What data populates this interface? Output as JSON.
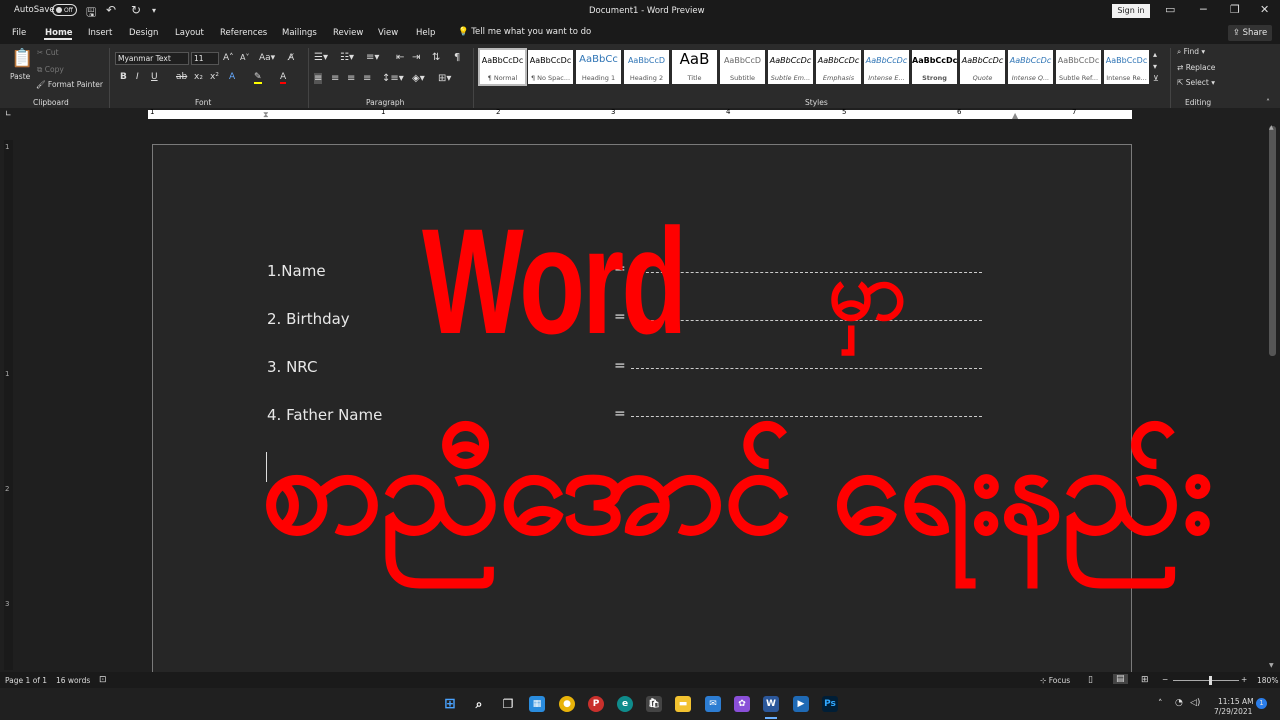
{
  "titlebar": {
    "autosave": "AutoSave",
    "toggle": "Off",
    "doc_title": "Document1  -  Word Preview",
    "sign_in": "Sign in"
  },
  "menu": {
    "tabs": [
      "File",
      "Home",
      "Insert",
      "Design",
      "Layout",
      "References",
      "Mailings",
      "Review",
      "View",
      "Help"
    ],
    "tell_me": "Tell me what you want to do",
    "share": "Share"
  },
  "ribbon": {
    "clipboard": {
      "paste": "Paste",
      "cut": "Cut",
      "copy": "Copy",
      "format_painter": "Format Painter",
      "label": "Clipboard"
    },
    "font": {
      "name": "Myanmar Text",
      "size": "11",
      "label": "Font"
    },
    "paragraph": {
      "label": "Paragraph"
    },
    "styles": {
      "label": "Styles",
      "items": [
        {
          "sample": "AaBbCcDc",
          "name": "¶ Normal"
        },
        {
          "sample": "AaBbCcDc",
          "name": "¶ No Spac..."
        },
        {
          "sample": "AaBbCc",
          "name": "Heading 1"
        },
        {
          "sample": "AaBbCcD",
          "name": "Heading 2"
        },
        {
          "sample": "AaB",
          "name": "Title"
        },
        {
          "sample": "AaBbCcD",
          "name": "Subtitle"
        },
        {
          "sample": "AaBbCcDc",
          "name": "Subtle Em..."
        },
        {
          "sample": "AaBbCcDc",
          "name": "Emphasis"
        },
        {
          "sample": "AaBbCcDc",
          "name": "Intense E..."
        },
        {
          "sample": "AaBbCcDc",
          "name": "Strong"
        },
        {
          "sample": "AaBbCcDc",
          "name": "Quote"
        },
        {
          "sample": "AaBbCcDc",
          "name": "Intense Q..."
        },
        {
          "sample": "AaBbCcDc",
          "name": "Subtle Ref..."
        },
        {
          "sample": "AaBbCcDc",
          "name": "Intense Re..."
        }
      ]
    },
    "editing": {
      "find": "Find",
      "replace": "Replace",
      "select": "Select",
      "label": "Editing"
    }
  },
  "ruler": {
    "numbers": [
      "1",
      "1",
      "2",
      "3",
      "4",
      "5",
      "6",
      "7"
    ]
  },
  "vruler": {
    "numbers": [
      "1",
      "1",
      "2",
      "3"
    ]
  },
  "document": {
    "lines": [
      {
        "label": "1.Name",
        "eq": "="
      },
      {
        "label": "2. Birthday",
        "eq": "="
      },
      {
        "label": "3. NRC",
        "eq": "="
      },
      {
        "label": "4. Father Name",
        "eq": "="
      }
    ],
    "overlay_word": "Word",
    "overlay_mya1": "မှာ",
    "overlay_mya2": "စာညီအောင် ရေးနည်း"
  },
  "status": {
    "page": "Page 1 of 1",
    "words": "16 words",
    "focus": "Focus",
    "zoom": "180%"
  },
  "taskbar": {
    "time": "11:15 AM",
    "date": "7/29/2021"
  }
}
